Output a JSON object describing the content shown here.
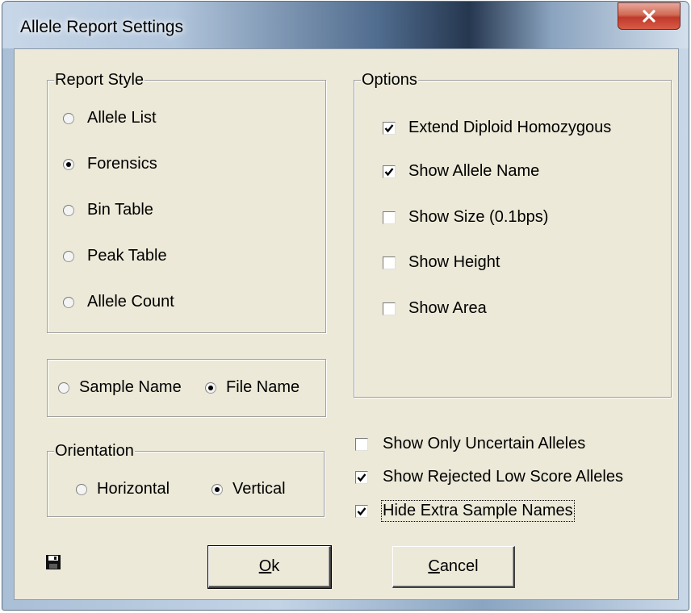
{
  "window": {
    "title": "Allele Report Settings",
    "close_glyph": "✕"
  },
  "report_style": {
    "legend": "Report Style",
    "options": [
      {
        "label": "Allele List",
        "selected": false
      },
      {
        "label": "Forensics",
        "selected": true
      },
      {
        "label": "Bin Table",
        "selected": false
      },
      {
        "label": "Peak Table",
        "selected": false
      },
      {
        "label": "Allele Count",
        "selected": false
      }
    ]
  },
  "name_source": {
    "options": [
      {
        "label": "Sample Name",
        "selected": false
      },
      {
        "label": "File Name",
        "selected": true
      }
    ]
  },
  "orientation": {
    "legend": "Orientation",
    "options": [
      {
        "label": "Horizontal",
        "selected": false
      },
      {
        "label": "Vertical",
        "selected": true
      }
    ]
  },
  "options": {
    "legend": "Options",
    "items": [
      {
        "label": "Extend Diploid Homozygous",
        "checked": true
      },
      {
        "label": "Show Allele Name",
        "checked": true
      },
      {
        "label": "Show Size (0.1bps)",
        "checked": false
      },
      {
        "label": "Show Height",
        "checked": false
      },
      {
        "label": "Show Area",
        "checked": false
      }
    ]
  },
  "extra_options": [
    {
      "label": "Show Only Uncertain Alleles",
      "checked": false
    },
    {
      "label": "Show Rejected Low Score Alleles",
      "checked": true
    },
    {
      "label": "Hide Extra Sample Names",
      "checked": true
    }
  ],
  "buttons": {
    "ok": {
      "mnemonic": "O",
      "rest": "k"
    },
    "cancel": {
      "mnemonic": "C",
      "rest": "ancel"
    }
  },
  "icons": {
    "save": "save-icon",
    "close": "close-icon"
  }
}
